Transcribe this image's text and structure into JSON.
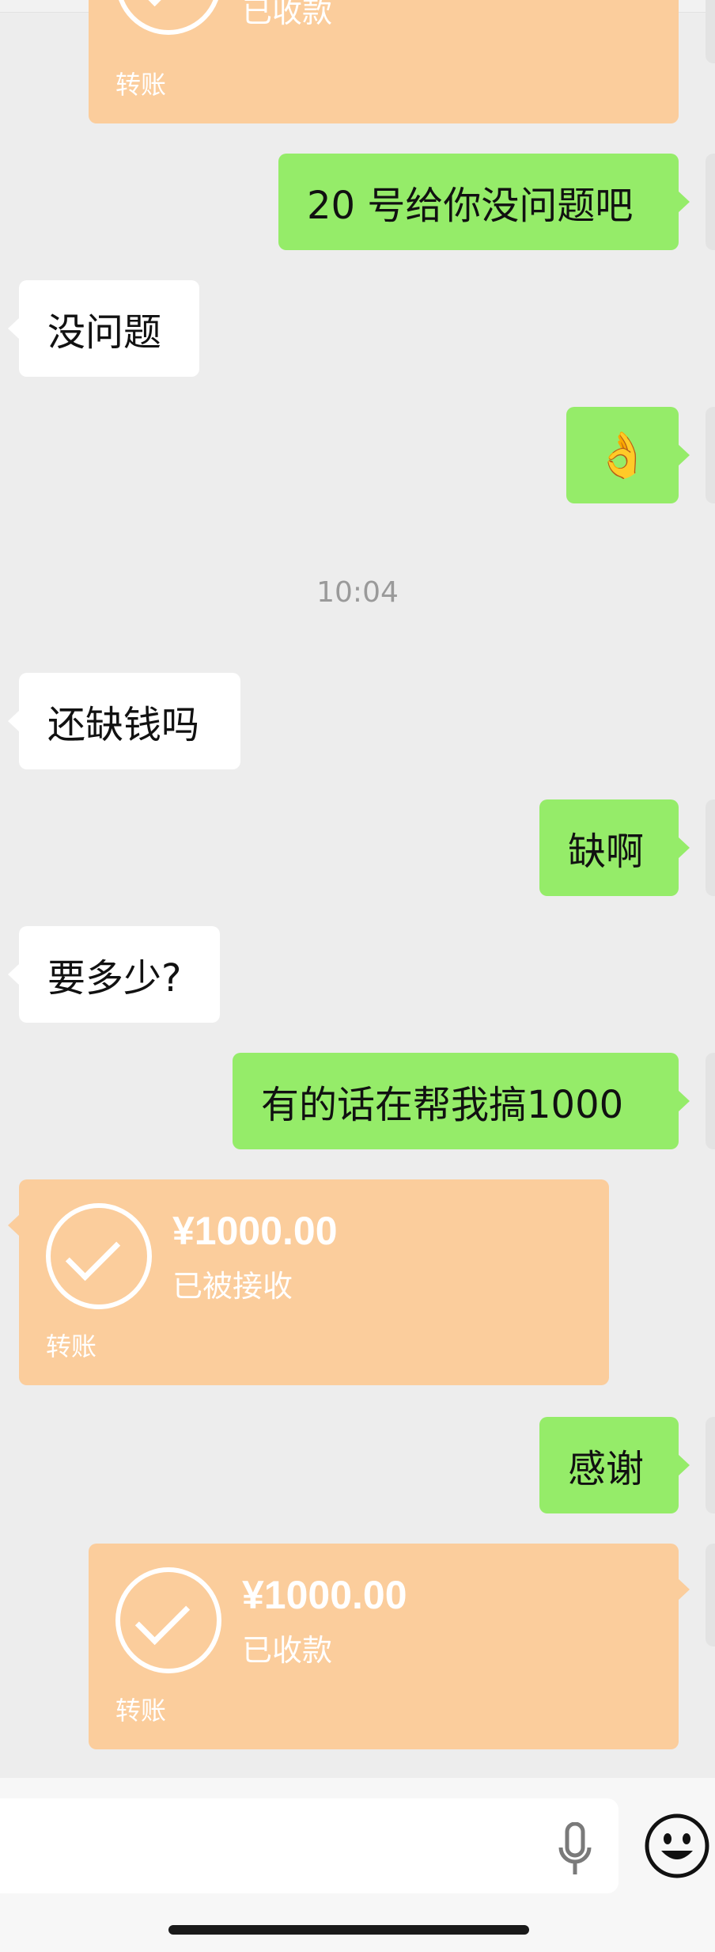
{
  "colors": {
    "background": "#ededed",
    "sent_bubble": "#95ec69",
    "received_bubble": "#ffffff",
    "transfer_card": "#fbcd9c"
  },
  "messages": {
    "m1_sent": "20 号给你没问题吧",
    "m2_received": "没问题",
    "m3_sent_emoji": "👌",
    "timestamp": "10:04",
    "m4_received": "还缺钱吗",
    "m5_sent": "缺啊",
    "m6_received": "要多少?",
    "m7_sent": "有的话在帮我搞1000",
    "m8_sent": "感谢"
  },
  "transfers": {
    "top_partial": {
      "status": "已收款",
      "label": "转账"
    },
    "received_transfer": {
      "amount": "¥1000.00",
      "status": "已被接收",
      "label": "转账"
    },
    "sent_transfer": {
      "amount": "¥1000.00",
      "status": "已收款",
      "label": "转账"
    }
  },
  "input_bar": {
    "voice_icon": "microphone-icon",
    "emoji_icon": "smiley-face-icon"
  }
}
